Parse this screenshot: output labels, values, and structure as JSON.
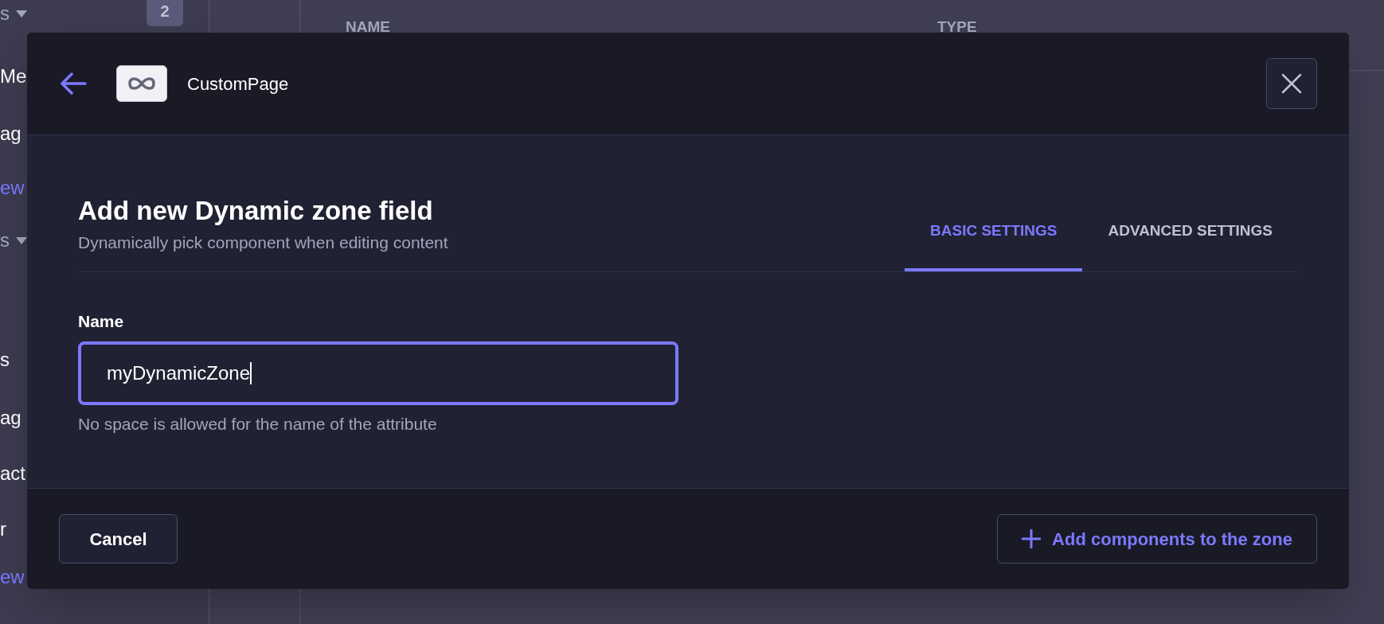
{
  "background": {
    "sidebar": {
      "items": [
        {
          "label": "s",
          "kind": "heading",
          "badge": "2"
        },
        {
          "label": "Me",
          "kind": "item"
        },
        {
          "label": "ag",
          "kind": "item"
        },
        {
          "label": "ew",
          "kind": "link"
        },
        {
          "label": "s",
          "kind": "heading"
        },
        {
          "label": "s",
          "kind": "item"
        },
        {
          "label": "ag",
          "kind": "item"
        },
        {
          "label": "act",
          "kind": "item"
        },
        {
          "label": "r",
          "kind": "item"
        },
        {
          "label": "ew",
          "kind": "link"
        }
      ]
    },
    "table": {
      "columns": [
        "NAME",
        "TYPE"
      ]
    }
  },
  "modal": {
    "header": {
      "title": "CustomPage"
    },
    "heading": "Add new Dynamic zone field",
    "subtitle": "Dynamically pick component when editing content",
    "tabs": [
      {
        "label": "BASIC SETTINGS",
        "selected": true
      },
      {
        "label": "ADVANCED SETTINGS",
        "selected": false
      }
    ],
    "field": {
      "label": "Name",
      "value": "myDynamicZone",
      "focused": true,
      "hint": "No space is allowed for the name of the attribute"
    },
    "buttons": [
      {
        "label": "Cancel",
        "kind": "secondary"
      },
      {
        "label": "Add components to the zone",
        "kind": "add"
      }
    ]
  }
}
